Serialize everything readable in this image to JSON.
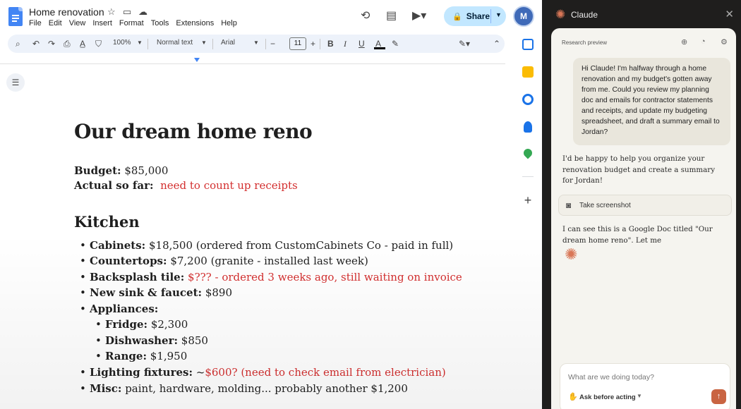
{
  "docs": {
    "title": "Home renovation",
    "menu": [
      "File",
      "Edit",
      "View",
      "Insert",
      "Format",
      "Tools",
      "Extensions",
      "Help"
    ],
    "share_label": "Share",
    "toolbar": {
      "zoom": "100%",
      "style": "Normal text",
      "font": "Arial",
      "font_size": "11",
      "bold": "B",
      "italic": "I",
      "underline": "U",
      "text_color": "A"
    },
    "doc": {
      "heading": "Our dream home reno",
      "budget_label": "Budget:",
      "budget_value": " $85,000",
      "actual_label": "Actual so far:",
      "actual_value": "need to count up receipts",
      "kitchen_heading": "Kitchen",
      "items": [
        {
          "label": "Cabinets:",
          "value": " $18,500 (ordered from CustomCabinets Co - paid in full)",
          "red": ""
        },
        {
          "label": "Countertops:",
          "value": " $7,200 (granite - installed last week)",
          "red": ""
        },
        {
          "label": "Backsplash tile:",
          "value": " ",
          "red": "$??? - ordered 3 weeks ago, still waiting on invoice"
        },
        {
          "label": "New sink & faucet:",
          "value": " $890",
          "red": ""
        },
        {
          "label": "Appliances:",
          "value": "",
          "red": ""
        },
        {
          "label": "Lighting fixtures:",
          "value": " ~",
          "red": "$600? (need to check email from electrician)"
        },
        {
          "label": "Misc:",
          "value": " paint, hardware, molding... probably another $1,200",
          "red": ""
        }
      ],
      "sub_items": [
        {
          "label": "Fridge:",
          "value": " $2,300"
        },
        {
          "label": "Dishwasher:",
          "value": " $850"
        },
        {
          "label": "Range:",
          "value": " $1,950"
        }
      ]
    }
  },
  "claude": {
    "app_name": "Claude",
    "preview_label": "Research preview",
    "user_message": "Hi Claude! I'm halfway through a home renovation and my budget's gotten away from me. Could you review my planning doc and emails for contractor statements and receipts, and update my budgeting spreadsheet, and draft a summary email to Jordan?",
    "reply_1": "I'd be happy to help you organize your renovation budget and create a summary for Jordan!",
    "tool_label": "Take screenshot",
    "reply_2": "I can see this is a Google Doc titled \"Our dream home reno\". Let me",
    "input_placeholder": "What are we doing today?",
    "mode_label": "Ask before acting"
  },
  "colors": {
    "accent_red": "#d32f2f",
    "share_bg": "#c2e7ff",
    "claude_orange": "#d97757",
    "claude_panel": "#f5f4ef"
  }
}
